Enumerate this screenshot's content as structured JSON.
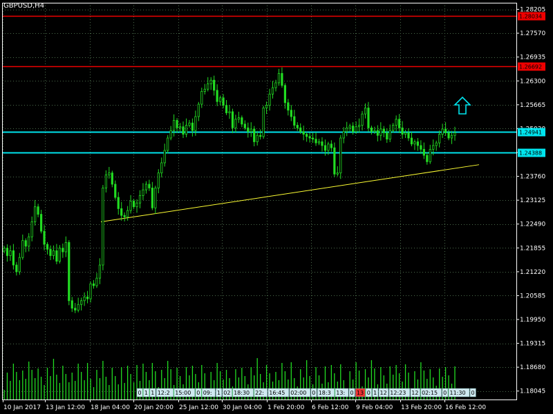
{
  "window": {
    "title": "GBPUSD,H4"
  },
  "colors": {
    "background": "#000000",
    "frame": "#ffffff",
    "grid": "#4d6d4d",
    "candle": "#22dd22",
    "volume": "#22dd22",
    "support_lines": "#00e5ee",
    "resistance_lines": "#ee0000",
    "trendline": "#ffff33",
    "arrow": "#00e5ee"
  },
  "icons": {
    "buy_arrow": "up-arrow-icon"
  },
  "price_axis": {
    "labels": [
      "1.28205",
      "1.27570",
      "1.26935",
      "1.26300",
      "1.25665",
      "1.25030",
      "1.24395",
      "1.23760",
      "1.23125",
      "1.22490",
      "1.21855",
      "1.21220",
      "1.20585",
      "1.19950",
      "1.19315",
      "1.18680",
      "1.18045"
    ],
    "min": 1.1782,
    "max": 1.2838
  },
  "time_axis": {
    "labels": [
      "10 Jan 2017",
      "13 Jan 12:00",
      "18 Jan 04:00",
      "20 Jan 20:00",
      "25 Jan 12:00",
      "30 Jan 04:00",
      "1 Feb 20:00",
      "6 Feb 12:00",
      "9 Feb 04:00",
      "13 Feb 20:00",
      "16 Feb 12:00"
    ]
  },
  "horizontal_lines": [
    {
      "name": "resistance-line-1",
      "price": 1.2803,
      "label": "1.28034",
      "kind": "resistance"
    },
    {
      "name": "resistance-line-2",
      "price": 1.2669,
      "label": "1.26692",
      "kind": "resistance"
    },
    {
      "name": "support-line-1",
      "price": 1.24941,
      "label": "1.24941",
      "kind": "support"
    },
    {
      "name": "support-line-2",
      "price": 1.24388,
      "label": "1.24388",
      "kind": "support"
    }
  ],
  "trendline": {
    "start_price": 1.2255,
    "end_price": 1.2407
  },
  "trade_markers": [
    "0",
    "1",
    "1",
    "12:2",
    "15:00",
    "0",
    "09:",
    "1",
    "02",
    "18:30",
    "22:",
    "16:45",
    "02:00",
    "0",
    "18:3",
    "13:",
    "0",
    "13",
    "0",
    "1",
    "12",
    "12:23",
    "12",
    "02:15",
    "0",
    "11:30",
    "0"
  ],
  "chart_data": {
    "type": "candlestick",
    "symbol": "GBPUSD",
    "timeframe": "H4",
    "close": [
      1.2185,
      1.2165,
      1.2178,
      1.214,
      1.2122,
      1.216,
      1.2205,
      1.219,
      1.2215,
      1.2255,
      1.2295,
      1.2275,
      1.223,
      1.2195,
      1.2182,
      1.2165,
      1.2178,
      1.215,
      1.2185,
      1.2175,
      1.22,
      1.2045,
      1.2025,
      1.202,
      1.2035,
      1.2045,
      1.2055,
      1.205,
      1.209,
      1.2085,
      1.2105,
      1.214,
      1.2345,
      1.238,
      1.2385,
      1.2355,
      1.232,
      1.229,
      1.2272,
      1.2268,
      1.2285,
      1.231,
      1.2295,
      1.2305,
      1.2325,
      1.234,
      1.2355,
      1.2345,
      1.2292,
      1.2345,
      1.2385,
      1.2412,
      1.2445,
      1.2478,
      1.2498,
      1.2525,
      1.2505,
      1.2508,
      1.2488,
      1.2512,
      1.2518,
      1.2498,
      1.2535,
      1.2568,
      1.2602,
      1.2608,
      1.2622,
      1.2632,
      1.2605,
      1.2575,
      1.2585,
      1.2565,
      1.2545,
      1.2548,
      1.2505,
      1.2528,
      1.2532,
      1.2515,
      1.2505,
      1.2495,
      1.2502,
      1.2468,
      1.2485,
      1.2482,
      1.2558,
      1.2565,
      1.2595,
      1.2612,
      1.2625,
      1.265,
      1.2618,
      1.2572,
      1.2552,
      1.2535,
      1.2512,
      1.2505,
      1.2495,
      1.2488,
      1.2482,
      1.2478,
      1.2475,
      1.2465,
      1.2468,
      1.2458,
      1.2445,
      1.2462,
      1.2452,
      1.2382,
      1.2385,
      1.2478,
      1.2495,
      1.2505,
      1.251,
      1.2495,
      1.2508,
      1.2512,
      1.2542,
      1.2558,
      1.2505,
      1.2495,
      1.2498,
      1.2485,
      1.2502,
      1.2492,
      1.2475,
      1.2498,
      1.2512,
      1.2528,
      1.2505,
      1.2488,
      1.2492,
      1.2478,
      1.2462,
      1.2468,
      1.2458,
      1.2448,
      1.2432,
      1.2415,
      1.2448,
      1.2458,
      1.2465,
      1.2488,
      1.2502,
      1.2492,
      1.2478,
      1.2485,
      1.2492
    ]
  }
}
